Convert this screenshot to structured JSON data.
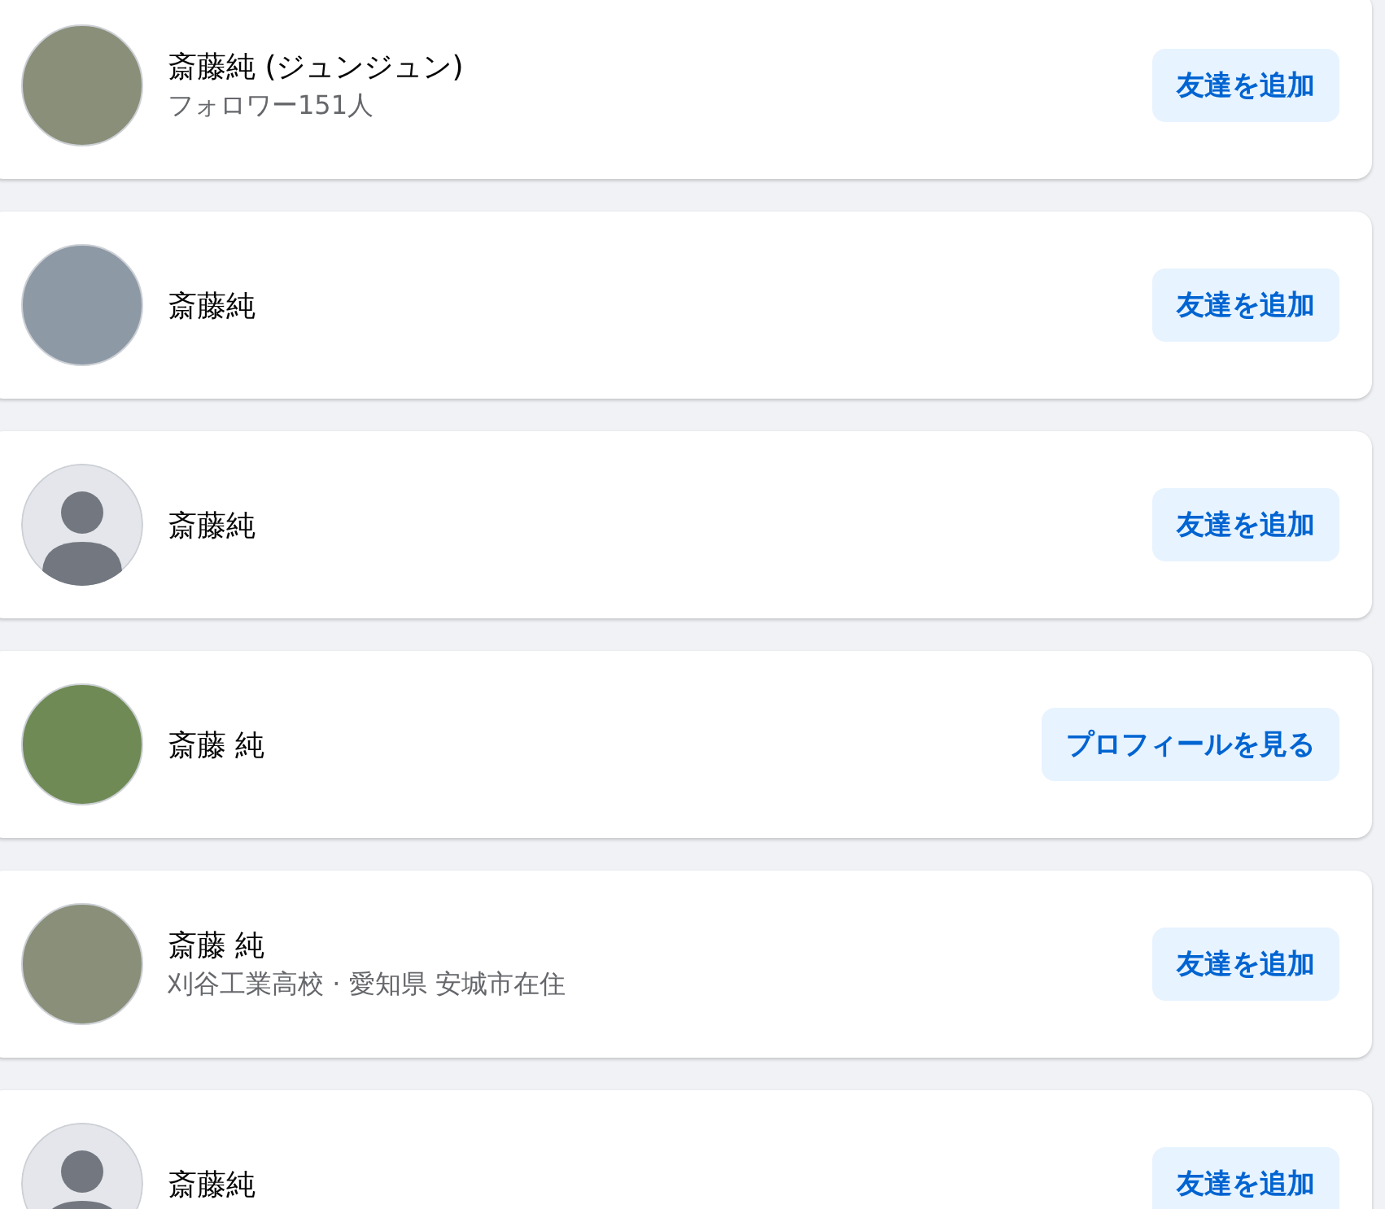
{
  "results": [
    {
      "kind": "photo",
      "name": "斎藤純 (ジュンジュン)",
      "subtitle": "フォロワー151人",
      "button": "友達を追加"
    },
    {
      "kind": "photo",
      "name": "斎藤純",
      "button": "友達を追加"
    },
    {
      "kind": "default",
      "name": "斎藤純",
      "button": "友達を追加"
    },
    {
      "kind": "photo",
      "name": "斎藤 純",
      "button": "プロフィールを見る"
    },
    {
      "kind": "photo",
      "name": "斎藤 純",
      "subtitle": "刈谷工業高校 · 愛知県 安城市在住",
      "button": "友達を追加"
    },
    {
      "kind": "default",
      "name": "斎藤純",
      "button": "友達を追加"
    }
  ]
}
